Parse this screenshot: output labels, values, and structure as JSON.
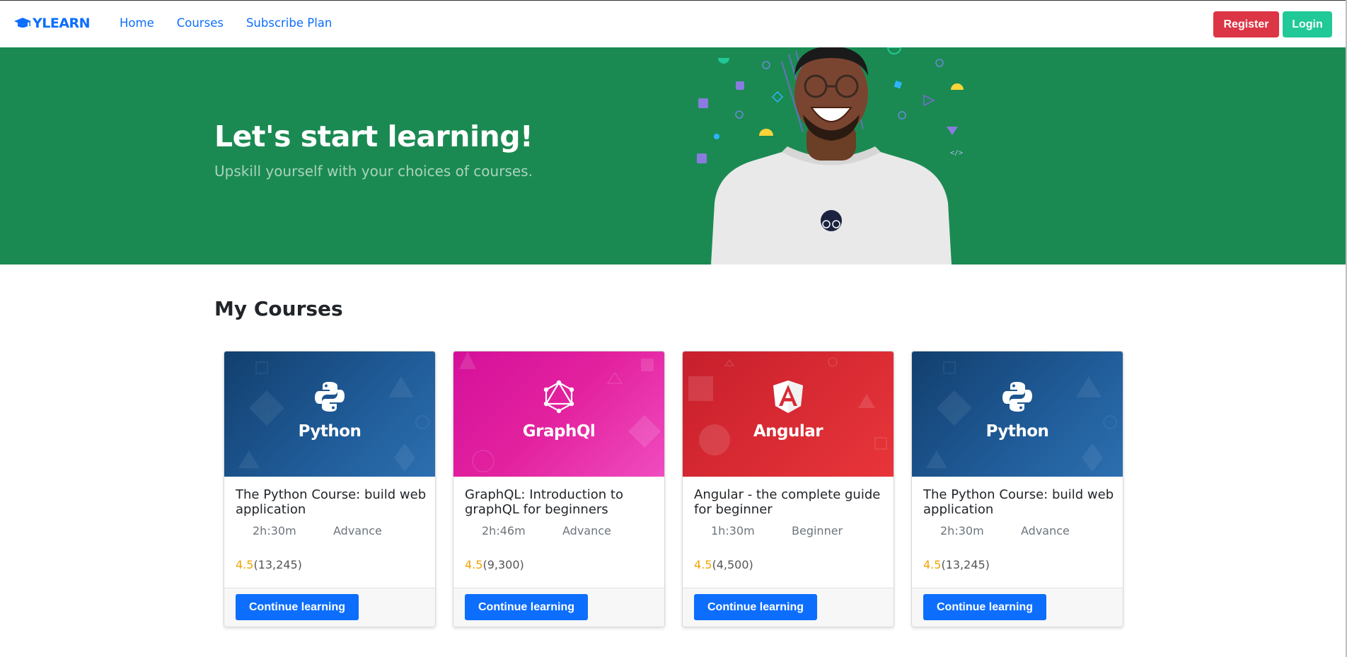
{
  "nav": {
    "brand": "YLEARN",
    "links": [
      "Home",
      "Courses",
      "Subscribe Plan"
    ],
    "register_label": "Register",
    "login_label": "Login"
  },
  "hero": {
    "title": "Let's start learning!",
    "subtitle": "Upskill yourself with your choices of courses."
  },
  "section": {
    "title": "My Courses"
  },
  "colors": {
    "primary": "#0d6efd",
    "hero_bg": "#1b8a52",
    "register": "#dc3545",
    "login": "#20c997",
    "rating": "#f0a500"
  },
  "courses": [
    {
      "tech": "Python",
      "logo_icon": "python-logo-icon",
      "title": "The Python Course: build web application",
      "duration": "2h:30m",
      "level": "Advance",
      "rating": "4.5",
      "reviews": "(13,245)",
      "cta": "Continue learning"
    },
    {
      "tech": "GraphQl",
      "logo_icon": "graphql-logo-icon",
      "title": "GraphQL: Introduction to graphQL for beginners",
      "duration": "2h:46m",
      "level": "Advance",
      "rating": "4.5",
      "reviews": "(9,300)",
      "cta": "Continue learning"
    },
    {
      "tech": "Angular",
      "logo_icon": "angular-logo-icon",
      "title": "Angular - the complete guide for beginner",
      "duration": "1h:30m",
      "level": "Beginner",
      "rating": "4.5",
      "reviews": "(4,500)",
      "cta": "Continue learning"
    },
    {
      "tech": "Python",
      "logo_icon": "python-logo-icon",
      "title": "The Python Course: build web application",
      "duration": "2h:30m",
      "level": "Advance",
      "rating": "4.5",
      "reviews": "(13,245)",
      "cta": "Continue learning"
    }
  ]
}
